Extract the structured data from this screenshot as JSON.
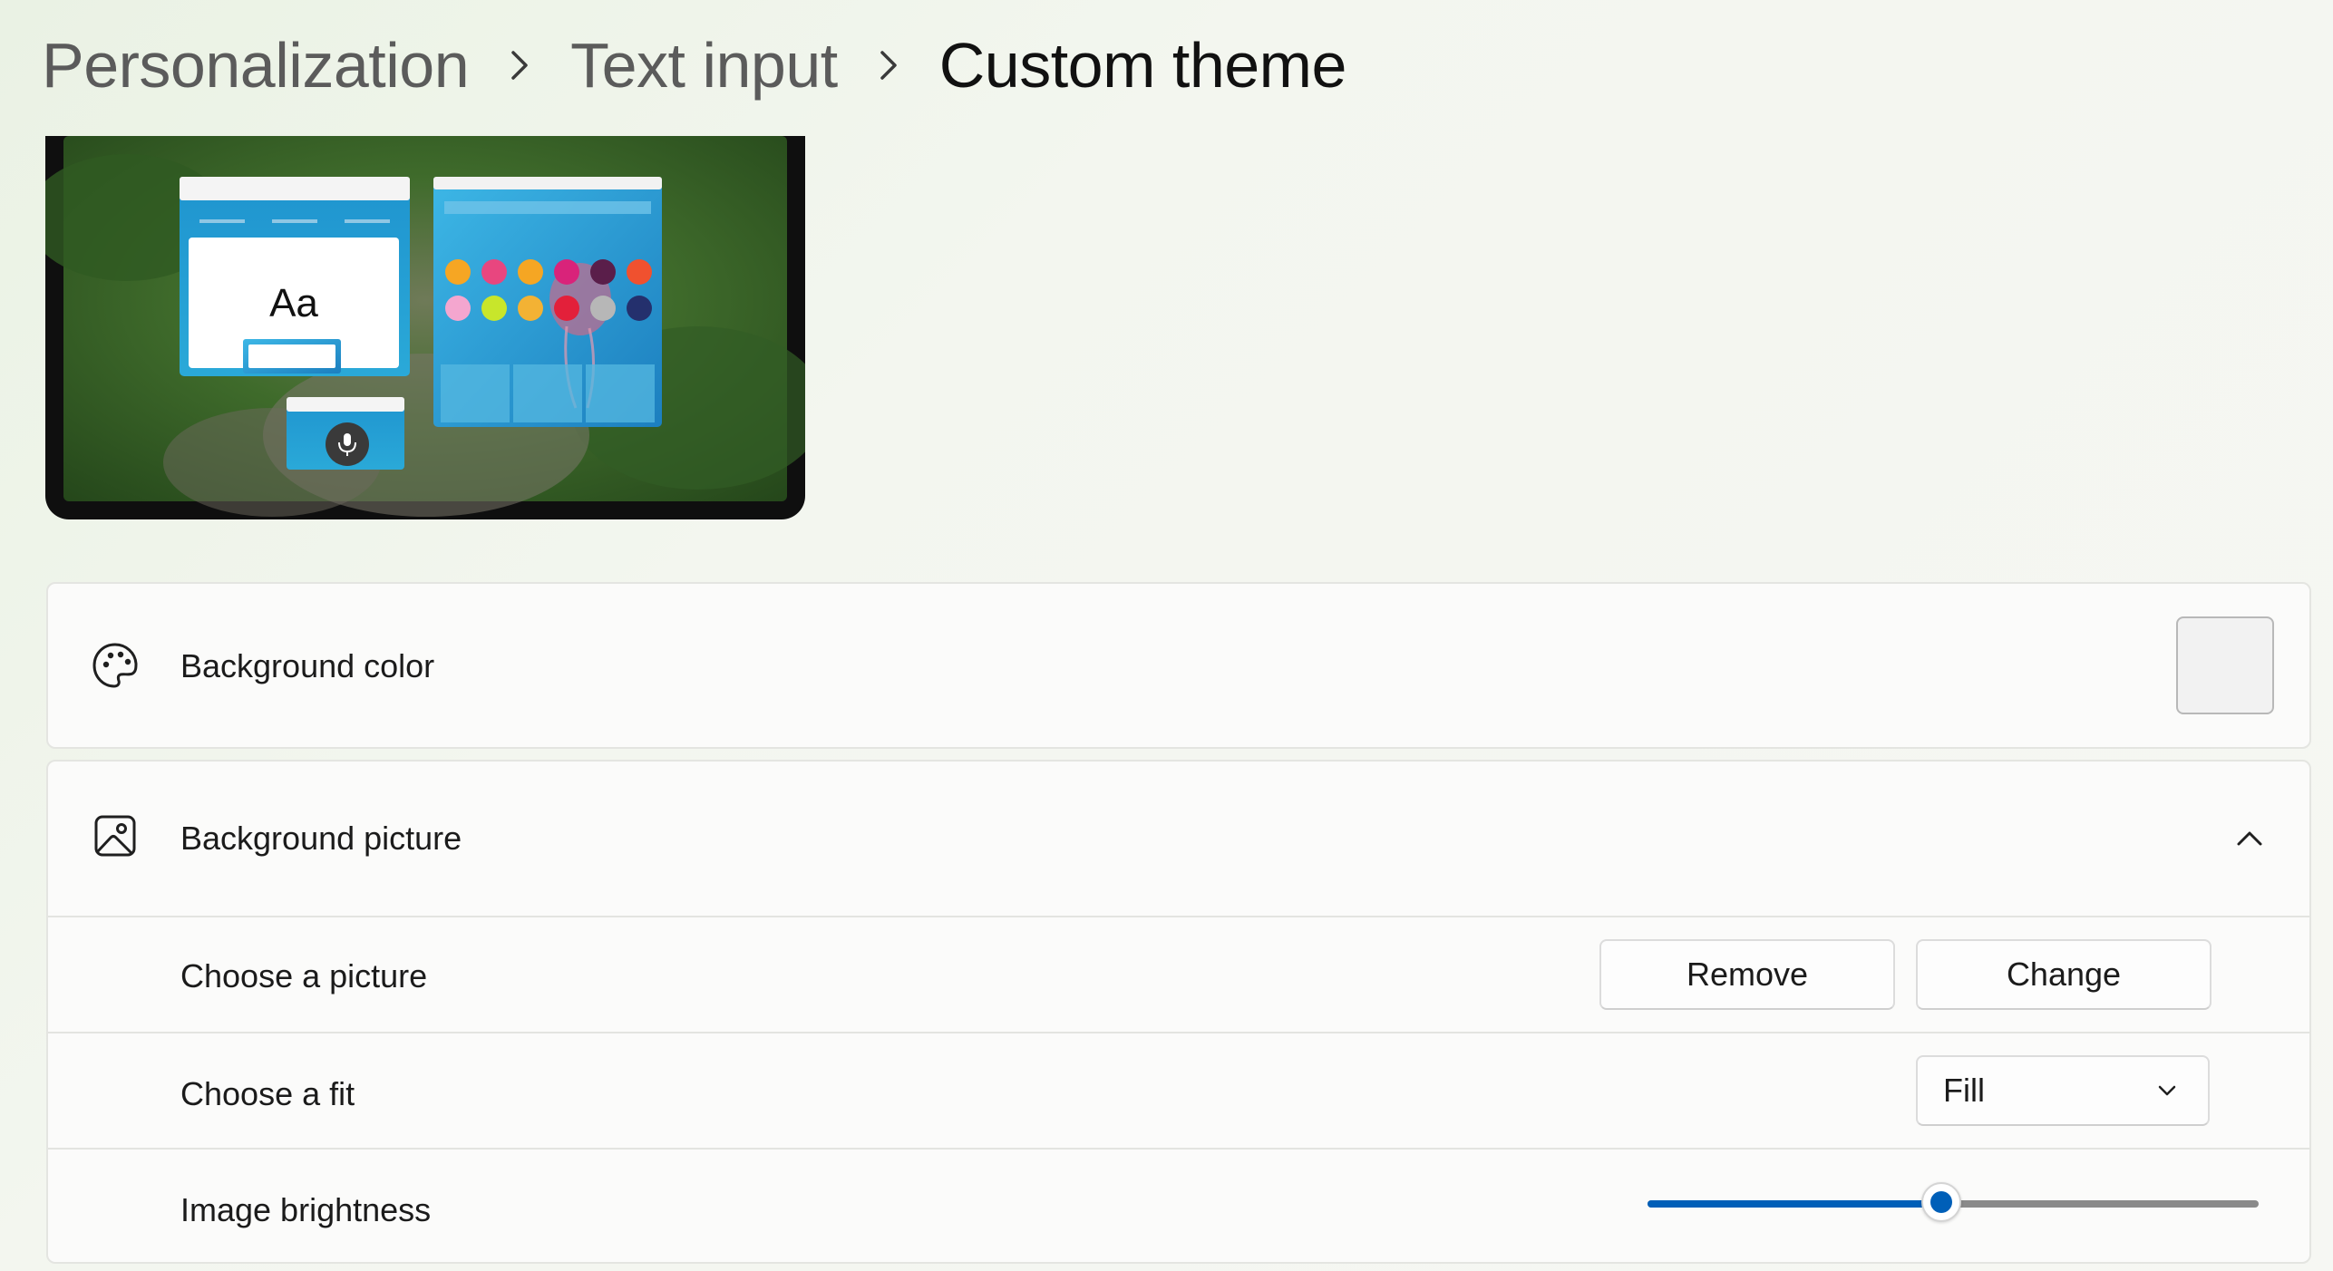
{
  "breadcrumb": {
    "items": [
      "Personalization",
      "Text input"
    ],
    "current": "Custom theme"
  },
  "preview": {
    "sample_text": "Aa",
    "icons": [
      "microphone-icon"
    ]
  },
  "background_color": {
    "label": "Background color",
    "icon": "palette-icon",
    "swatch_color": "#f2f2f2"
  },
  "background_picture": {
    "label": "Background picture",
    "icon": "picture-icon",
    "expanded": true,
    "choose_picture": {
      "label": "Choose a picture",
      "remove_label": "Remove",
      "change_label": "Change"
    },
    "choose_fit": {
      "label": "Choose a fit",
      "value": "Fill"
    },
    "image_brightness": {
      "label": "Image brightness",
      "value_fraction": 0.48
    }
  },
  "colors": {
    "accent": "#005fb8"
  }
}
